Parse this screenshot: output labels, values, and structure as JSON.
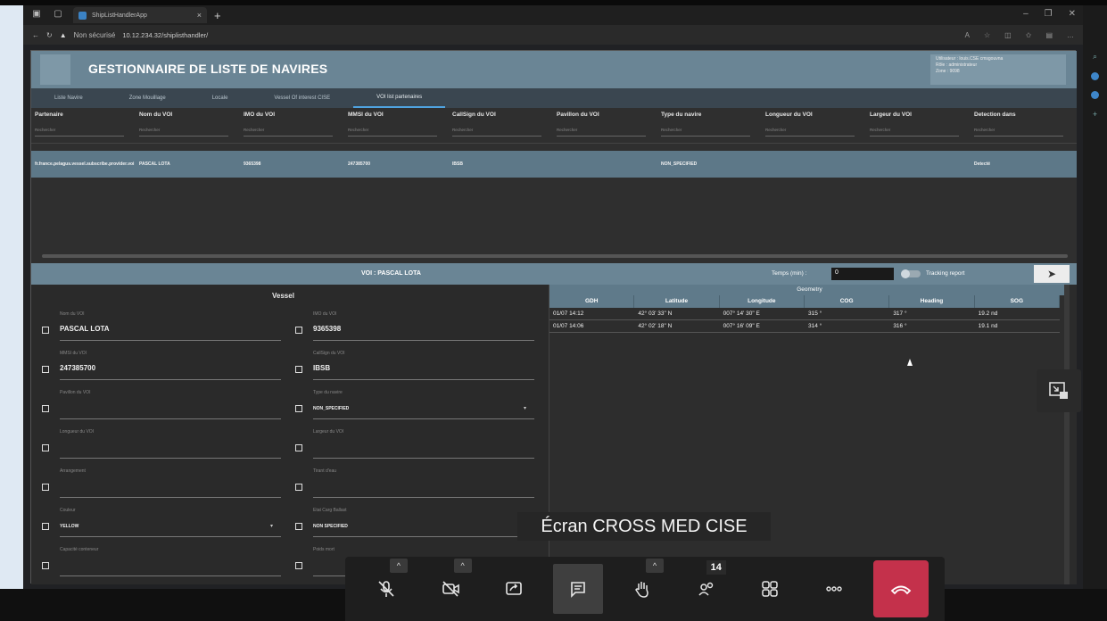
{
  "browser": {
    "tab_title": "ShipListHandlerApp",
    "security": "Non sécurisé",
    "url": "10.12.234.32/shiplisthandler/"
  },
  "app": {
    "title": "GESTIONNAIRE DE LISTE DE NAVIRES",
    "user_info": [
      "Utilisateur : louis.CSE cmsgouvna",
      "Rôle : administrateur",
      "Zone : 9098"
    ]
  },
  "nav": {
    "tabs": [
      "Liste Navire",
      "Zone Mouillage",
      "Locale",
      "Vessel Of interest CISE",
      "VOI list partenaires"
    ],
    "active_index": 4
  },
  "grid": {
    "columns": [
      "Partenaire",
      "Nom du VOI",
      "IMO du VOI",
      "MMSI du VOI",
      "CallSign du VOI",
      "Pavillon du VOI",
      "Type du navire",
      "Longueur du VOI",
      "Largeur du VOI",
      "Detection dans"
    ],
    "filter_placeholder": "Rechercher",
    "rows": [
      [
        "fr.france.pelagus.vessel.subscribe.provider.voi",
        "PASCAL LOTA",
        "9365398",
        "247385700",
        "IBSB",
        "",
        "NON_SPECIFIED",
        "",
        "",
        "Detecté"
      ]
    ]
  },
  "detail": {
    "voi_label": "VOI : PASCAL LOTA",
    "temps_label": "Temps (min) :",
    "temps_value": "0",
    "tracking_label": "Tracking report",
    "send_icon": "send-icon",
    "vessel_title": "Vessel",
    "fields_left": [
      {
        "label": "Nom du VOI",
        "value": "PASCAL LOTA",
        "small": false,
        "dropdown": false
      },
      {
        "label": "MMSI du VOI",
        "value": "247385700",
        "small": false,
        "dropdown": false
      },
      {
        "label": "Pavillon du VOI",
        "value": "",
        "small": false,
        "dropdown": false
      },
      {
        "label": "Longueur du VOI",
        "value": "",
        "small": false,
        "dropdown": false
      },
      {
        "label": "Arrangement",
        "value": "",
        "small": false,
        "dropdown": false
      },
      {
        "label": "Couleur",
        "value": "YELLOW",
        "small": true,
        "dropdown": true
      },
      {
        "label": "Capacité conteneur",
        "value": "",
        "small": false,
        "dropdown": false
      }
    ],
    "fields_right": [
      {
        "label": "IMO du VOI",
        "value": "9365398",
        "small": false,
        "dropdown": false
      },
      {
        "label": "CallSign du VOI",
        "value": "IBSB",
        "small": false,
        "dropdown": false
      },
      {
        "label": "Type du navire",
        "value": "NON_SPECIFIED",
        "small": true,
        "dropdown": true
      },
      {
        "label": "Largeur du VOI",
        "value": "",
        "small": false,
        "dropdown": false
      },
      {
        "label": "Tirant d'eau",
        "value": "",
        "small": false,
        "dropdown": false
      },
      {
        "label": "Etat Carg Ballast",
        "value": "NON SPECIFIED",
        "small": true,
        "dropdown": false
      },
      {
        "label": "Poids mort",
        "value": "",
        "small": false,
        "dropdown": false
      }
    ],
    "geometry": {
      "title": "Geometry",
      "headers": [
        "GDH",
        "Latitude",
        "Longitude",
        "COG",
        "Heading",
        "SOG"
      ],
      "rows": [
        [
          "01/07 14:12",
          "42° 03' 33\" N",
          "007° 14' 30\" E",
          "315 °",
          "317 °",
          "19.2 nd"
        ],
        [
          "01/07 14:06",
          "42° 02' 18\" N",
          "007° 16' 09\" E",
          "314 °",
          "316 °",
          "19.1 nd"
        ]
      ]
    }
  },
  "caption": "Écran CROSS MED CISE",
  "teams": {
    "buttons": [
      "mic-off-icon",
      "camera-off-icon",
      "share-screen-icon",
      "chat-icon",
      "raise-hand-icon",
      "participants-icon",
      "apps-icon",
      "more-icon",
      "hang-up-icon"
    ],
    "participants_count": "14"
  },
  "colors": {
    "header": "#6a8595",
    "selected_row": "#5d7888",
    "hangup": "#c4314b"
  }
}
